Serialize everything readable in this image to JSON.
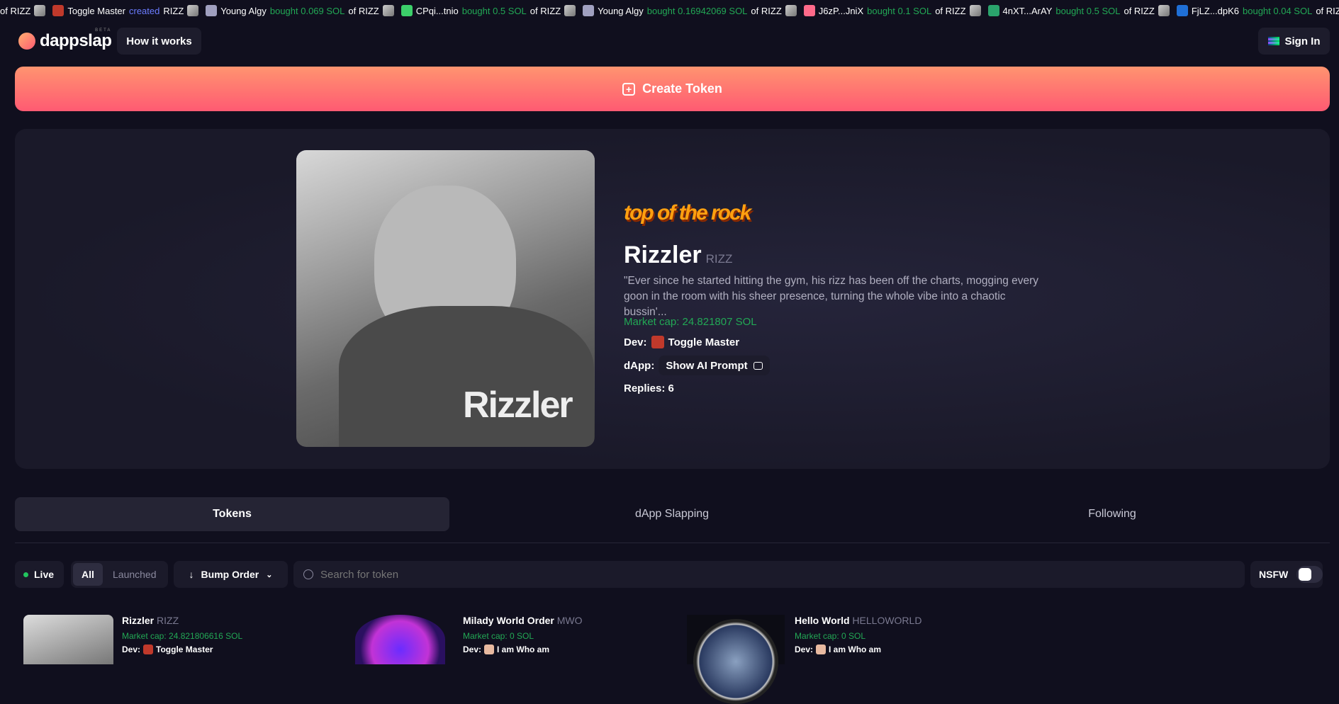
{
  "ticker": [
    {
      "user": "",
      "action": "",
      "amount": "of RIZZ",
      "avatar": "#888"
    },
    {
      "user": "Toggle Master",
      "action": "created",
      "amount": "RIZZ",
      "avatar": "#c0392b",
      "created": true
    },
    {
      "user": "Young Algy",
      "action": "bought 0.069 SOL",
      "amount": "of RIZZ",
      "avatar": "#a0a0c0"
    },
    {
      "user": "CPqi...tnio",
      "action": "bought 0.5 SOL",
      "amount": "of RIZZ",
      "avatar": "#3ccf6a"
    },
    {
      "user": "Young Algy",
      "action": "bought 0.16942069 SOL",
      "amount": "of RIZZ",
      "avatar": "#a0a0c0"
    },
    {
      "user": "J6zP...JniX",
      "action": "bought 0.1 SOL",
      "amount": "of RIZZ",
      "avatar": "#ff6a8a"
    },
    {
      "user": "4nXT...ArAY",
      "action": "bought 0.5 SOL",
      "amount": "of RIZZ",
      "avatar": "#2aa36c"
    },
    {
      "user": "FjLZ...dpK6",
      "action": "bought 0.04 SOL",
      "amount": "of RIZZ",
      "avatar": "#1f6fd6"
    }
  ],
  "header": {
    "logo": "dappslap",
    "beta": "BETA",
    "how": "How it works",
    "signin": "Sign In"
  },
  "create": "Create Token",
  "hero": {
    "badge": "top of the rock",
    "name": "Rizzler",
    "ticker": "RIZZ",
    "image_text": "Rizzler",
    "description": "\"Ever since he started hitting the gym, his rizz has been off the charts, mogging every goon in the room with his sheer presence, turning the whole vibe into a chaotic bussin'...",
    "market_cap": "Market cap: 24.821807 SOL",
    "dev_label": "Dev:",
    "dev": "Toggle Master",
    "dapp_label": "dApp:",
    "prompt": "Show AI Prompt",
    "replies": "Replies: 6"
  },
  "tabs": [
    "Tokens",
    "dApp Slapping",
    "Following"
  ],
  "filters": {
    "live": "Live",
    "all": "All",
    "launched": "Launched",
    "sort": "Bump Order",
    "search_placeholder": "Search for token",
    "nsfw": "NSFW",
    "nsfw_on": false
  },
  "cards": [
    {
      "name": "Rizzler",
      "ticker": "RIZZ",
      "market_cap": "Market cap: 24.821806616 SOL",
      "dev_label": "Dev:",
      "dev": "Toggle Master"
    },
    {
      "name": "Milady World Order",
      "ticker": "MWO",
      "market_cap": "Market cap: 0 SOL",
      "dev_label": "Dev:",
      "dev": "I am Who am"
    },
    {
      "name": "Hello World",
      "ticker": "HELLOWORLD",
      "market_cap": "Market cap: 0 SOL",
      "dev_label": "Dev:",
      "dev": "I am Who am"
    }
  ]
}
